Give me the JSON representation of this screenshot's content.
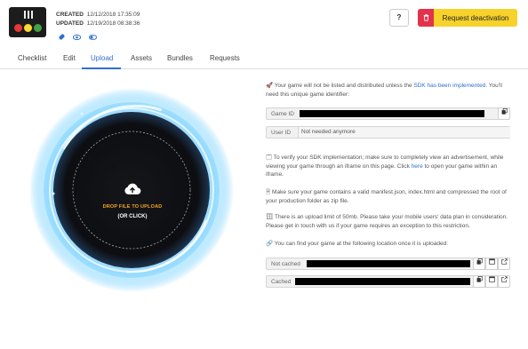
{
  "header": {
    "created_label": "CREATED",
    "created_value": "12/12/2018 17:35:09",
    "updated_label": "UPDATED",
    "updated_value": "12/19/2018 08:38:36",
    "help_label": "?",
    "deactivate_label": "Request deactivation"
  },
  "icons": {
    "meta": [
      "rocket-icon",
      "eye-icon",
      "toggle-icon"
    ],
    "deactivate": "trash-icon",
    "copy": "copy-icon",
    "window": "window-icon",
    "external": "external-link-icon"
  },
  "tabs": [
    {
      "label": "Checklist"
    },
    {
      "label": "Edit"
    },
    {
      "label": "Upload",
      "active": true
    },
    {
      "label": "Assets"
    },
    {
      "label": "Bundles"
    },
    {
      "label": "Requests"
    }
  ],
  "upload": {
    "title": "DROP FILE TO UPLOAD",
    "subtitle": "(OR CLICK)"
  },
  "info": {
    "intro_pre": "Your game will not be listed and distributed unless the ",
    "intro_link": "SDK has been implemented",
    "intro_post": ". You'll need this unique game identifier:",
    "game_id_label": "Game ID",
    "user_id_label": "User ID",
    "user_id_value": "Not needed anymore",
    "verify_pre": "To verify your SDK implementation; make sure to completely view an advertisement, while viewing your game through an iframe on this page. Click ",
    "verify_link": "here",
    "verify_post": " to open your game within an iframe.",
    "manifest": "Make sure your game contains a valid manifest.json, index.html and compressed the root of your production folder as zip file.",
    "limit": "There is an upload limit of 50mb. Please take your mobile users' data plan in consideration. Please get in touch with us if your game requires an exception to this restriction.",
    "location": "You can find your game at the following location once it is uploaded:",
    "not_cached_label": "Not cached",
    "cached_label": "Cached"
  },
  "colors": {
    "accent": "#2f6fd0",
    "deactivate_bg": "#f6d22b",
    "deactivate_icon_bg": "#e2334a",
    "upload_title": "#f6a623",
    "portal_glow": "#4fc3ff"
  }
}
